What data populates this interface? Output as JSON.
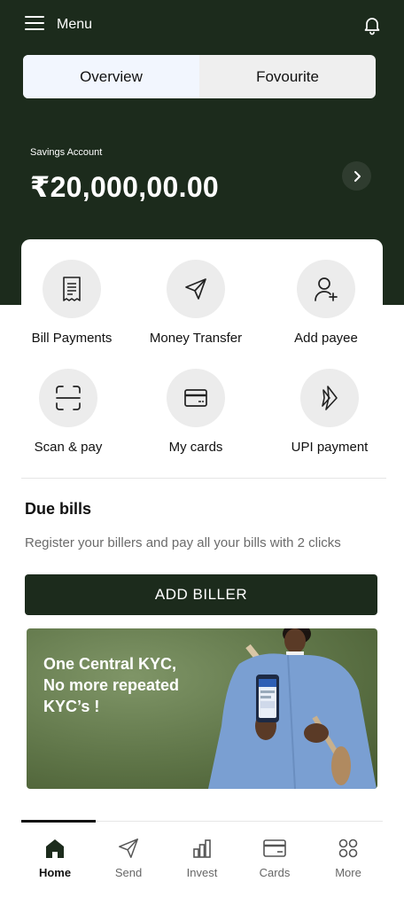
{
  "header": {
    "menu_label": "Menu",
    "icons": {
      "menu": "hamburger-icon",
      "notifications": "bell-icon"
    }
  },
  "segments": {
    "tabs": [
      {
        "label": "Overview",
        "active": true
      },
      {
        "label": "Fovourite",
        "active": false
      }
    ]
  },
  "account": {
    "type": "Savings Account",
    "balance": "₹20,000,00.00",
    "arrow_icon": "chevron-right-icon"
  },
  "quick_actions": [
    {
      "label": "Bill Payments",
      "icon": "receipt-icon"
    },
    {
      "label": "Money Transfer",
      "icon": "send-icon"
    },
    {
      "label": "Add payee",
      "icon": "user-plus-icon"
    },
    {
      "label": "Scan & pay",
      "icon": "scan-icon"
    },
    {
      "label": "My cards",
      "icon": "card-icon"
    },
    {
      "label": "UPI payment",
      "icon": "upi-icon"
    }
  ],
  "due_bills": {
    "title": "Due bills",
    "subtitle": "Register your billers and pay all your bills with 2 clicks",
    "button": "ADD BILLER"
  },
  "banner": {
    "lines": [
      "One Central KYC,",
      "No more repeated",
      "KYC’s !"
    ]
  },
  "bottom_nav": [
    {
      "label": "Home",
      "icon": "home-icon",
      "active": true
    },
    {
      "label": "Send",
      "icon": "send-icon",
      "active": false
    },
    {
      "label": "Invest",
      "icon": "bar-chart-icon",
      "active": false
    },
    {
      "label": "Cards",
      "icon": "card-icon",
      "active": false
    },
    {
      "label": "More",
      "icon": "grid-icon",
      "active": false
    }
  ],
  "colors": {
    "primary": "#1c2b1c",
    "active_tab_bg": "#f2f6fe",
    "icon_circle_bg": "#ececec",
    "banner_green": "#5e7447"
  }
}
